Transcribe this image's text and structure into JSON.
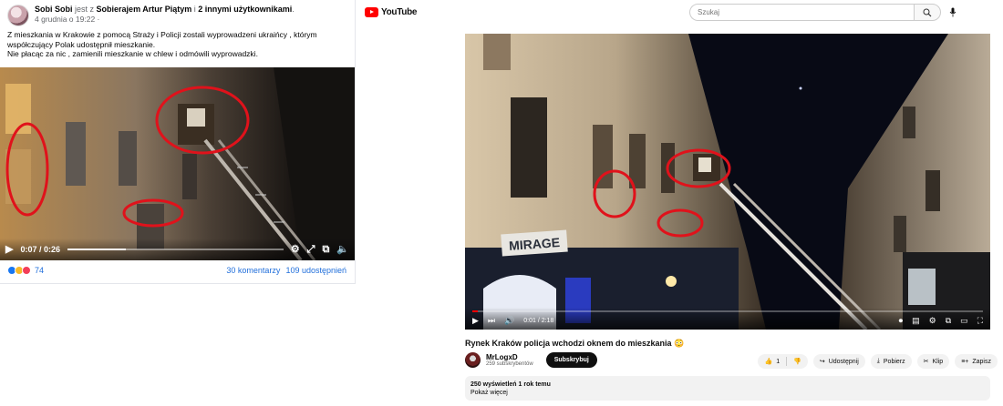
{
  "facebook": {
    "author": "Sobi Sobi",
    "with_text": "jest z",
    "tagged": "Sobierajem Artur Piątym",
    "and_text": "i",
    "others": "2 innymi użytkownikami",
    "date": "4 grudnia o 19:22 ·",
    "post_lines": [
      "Z mieszkania w Krakowie z pomocą Straży i Policji zostali wyprowadzeni ukraińcy , którym",
      "współczujący Polak udostępnił mieszkanie.",
      "Nie płacąc za nic , zamienili mieszkanie w chlew i odmówili wyprowadzki."
    ],
    "video": {
      "time": "0:07 / 0:26",
      "progress": 0.27
    },
    "reactions_count": "74",
    "comments": "30 komentarzy",
    "shares": "109 udostępnień"
  },
  "youtube": {
    "logo_text": "YouTube",
    "search_placeholder": "Szukaj",
    "video": {
      "time": "0:01 / 2:18",
      "progress": 0.01
    },
    "title": "Rynek Kraków policja wchodzi oknem do mieszkania 😳",
    "channel": {
      "name": "MrLogxD",
      "subs": "259 subskrybentów"
    },
    "subscribe_label": "Subskrybuj",
    "likes": "1",
    "share_label": "Udostępnij",
    "download_label": "Pobierz",
    "clip_label": "Klip",
    "save_label": "Zapisz",
    "desc_views": "250 wyświetleń  1 rok temu",
    "show_more": "Pokaż więcej",
    "sign_text": "MIRAGE"
  },
  "colors": {
    "annotation_red": "#e0121b",
    "link_blue": "#216fdb",
    "yt_red": "#ff0000"
  }
}
